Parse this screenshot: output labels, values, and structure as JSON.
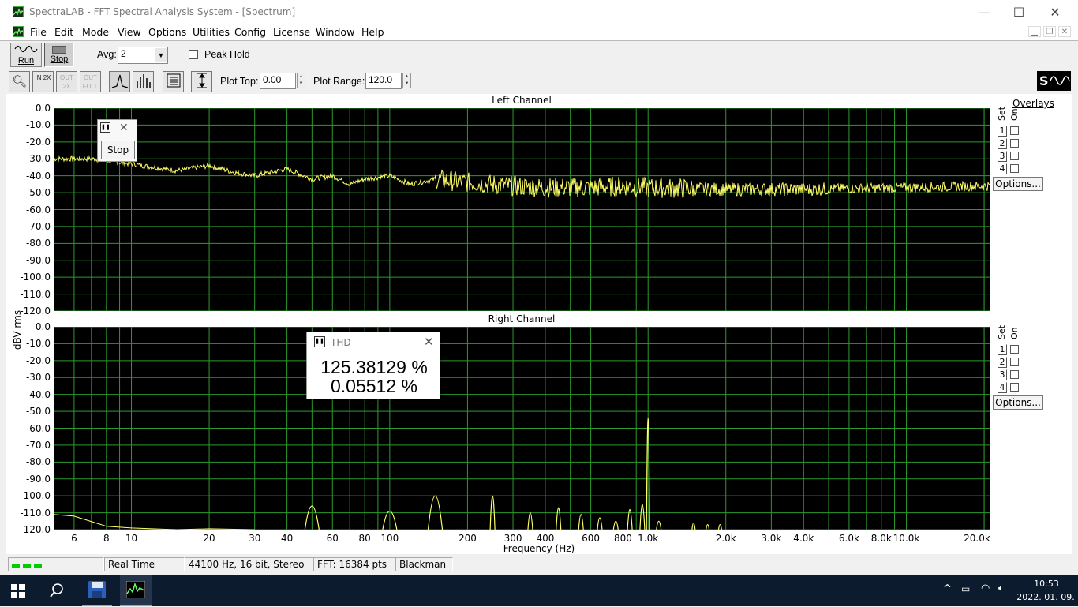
{
  "window": {
    "title": "SpectraLAB - FFT Spectral Analysis System - [Spectrum]",
    "minimize": "—",
    "maximize": "☐",
    "close": "✕"
  },
  "menu": [
    "File",
    "Edit",
    "Mode",
    "View",
    "Options",
    "Utilities",
    "Config",
    "License",
    "Window",
    "Help"
  ],
  "toolbar": {
    "run_label": "Run",
    "stop_label": "Stop",
    "avg_label": "Avg:",
    "avg_value": "2",
    "peak_hold_label": "Peak Hold",
    "peak_hold_checked": false,
    "zoom_in_label": "IN 2X",
    "zoom_out_label": "OUT 2X",
    "zoom_full_label": "OUT FULL",
    "plot_top_label": "Plot Top:",
    "plot_top_value": "0.00",
    "plot_range_label": "Plot Range:",
    "plot_range_value": "120.0"
  },
  "plots": {
    "y_axis_label": "dBV rms",
    "x_axis_label": "Frequency (Hz)",
    "y_ticks": [
      "0.0",
      "-10.0",
      "-20.0",
      "-30.0",
      "-40.0",
      "-50.0",
      "-60.0",
      "-70.0",
      "-80.0",
      "-90.0",
      "-100.0",
      "-110.0",
      "-120.0"
    ],
    "x_ticks": [
      {
        "label": "6",
        "f": 6
      },
      {
        "label": "8",
        "f": 8
      },
      {
        "label": "10",
        "f": 10
      },
      {
        "label": "20",
        "f": 20
      },
      {
        "label": "30",
        "f": 30
      },
      {
        "label": "40",
        "f": 40
      },
      {
        "label": "60",
        "f": 60
      },
      {
        "label": "80",
        "f": 80
      },
      {
        "label": "100",
        "f": 100
      },
      {
        "label": "200",
        "f": 200
      },
      {
        "label": "300",
        "f": 300
      },
      {
        "label": "400",
        "f": 400
      },
      {
        "label": "600",
        "f": 600
      },
      {
        "label": "800",
        "f": 800
      },
      {
        "label": "1.0k",
        "f": 1000
      },
      {
        "label": "2.0k",
        "f": 2000
      },
      {
        "label": "3.0k",
        "f": 3000
      },
      {
        "label": "4.0k",
        "f": 4000
      },
      {
        "label": "6.0k",
        "f": 6000
      },
      {
        "label": "8.0k",
        "f": 8000
      },
      {
        "label": "10.0k",
        "f": 10000
      },
      {
        "label": "20.0k",
        "f": 20000
      }
    ],
    "left_title": "Left Channel",
    "right_title": "Right Channel",
    "overlays_label": "Overlays",
    "set_label": "Set",
    "on_label": "On",
    "overlay_sets": [
      "1",
      "2",
      "3",
      "4"
    ],
    "options_label": "Options..."
  },
  "chart_data": [
    {
      "type": "line",
      "title": "Left Channel",
      "xlabel": "Frequency (Hz)",
      "ylabel": "dBV rms",
      "x_scale": "log",
      "xlim": [
        5,
        21000
      ],
      "ylim": [
        -120,
        0
      ],
      "grid": true,
      "series": [
        {
          "color": "#ffff66",
          "x": [
            5,
            7,
            8,
            10,
            15,
            20,
            25,
            30,
            40,
            50,
            60,
            70,
            80,
            100,
            120,
            150,
            200,
            300,
            400,
            600,
            800,
            1000,
            2000,
            4000,
            10000,
            20000
          ],
          "y": [
            -30,
            -30,
            -31,
            -33,
            -37,
            -34,
            -38,
            -40,
            -36,
            -42,
            -40,
            -45,
            -42,
            -40,
            -45,
            -42,
            -44,
            -46,
            -47,
            -47,
            -46,
            -47,
            -48,
            -48,
            -47,
            -46
          ]
        }
      ]
    },
    {
      "type": "line",
      "title": "Right Channel",
      "xlabel": "Frequency (Hz)",
      "ylabel": "dBV rms",
      "x_scale": "log",
      "xlim": [
        5,
        21000
      ],
      "ylim": [
        -120,
        0
      ],
      "grid": true,
      "series": [
        {
          "color": "#ffff66",
          "peaks": [
            {
              "f": 50,
              "y": -106
            },
            {
              "f": 100,
              "y": -109
            },
            {
              "f": 150,
              "y": -100
            },
            {
              "f": 250,
              "y": -100
            },
            {
              "f": 350,
              "y": -110
            },
            {
              "f": 450,
              "y": -107
            },
            {
              "f": 550,
              "y": -111
            },
            {
              "f": 650,
              "y": -113
            },
            {
              "f": 750,
              "y": -115
            },
            {
              "f": 850,
              "y": -108
            },
            {
              "f": 950,
              "y": -105
            },
            {
              "f": 1000,
              "y": -54
            },
            {
              "f": 1100,
              "y": -115
            },
            {
              "f": 1500,
              "y": -116
            },
            {
              "f": 1700,
              "y": -117
            },
            {
              "f": 1900,
              "y": -117
            }
          ],
          "low_end": {
            "x": [
              5,
              6,
              8,
              10,
              12,
              15,
              20,
              30
            ],
            "y": [
              -111,
              -112,
              -118,
              -119,
              -119.5,
              -120,
              -119.5,
              -120
            ]
          }
        }
      ]
    }
  ],
  "stop_popup": {
    "button_label": "Stop",
    "close": "✕"
  },
  "thd_popup": {
    "title": "THD",
    "close": "✕",
    "value1": "125.38129 %",
    "value2": "0.05512 %"
  },
  "status": {
    "mode": "Real Time",
    "format": "44100 Hz, 16 bit, Stereo",
    "fft": "FFT: 16384 pts",
    "window": "Blackman"
  },
  "taskbar": {
    "time": "10:53",
    "date": "2022. 01. 09."
  },
  "colors": {
    "trace": "#ffff66",
    "grid": "#2d9a2d",
    "plot_bg": "#000000",
    "taskbar": "#0d1b2e"
  }
}
